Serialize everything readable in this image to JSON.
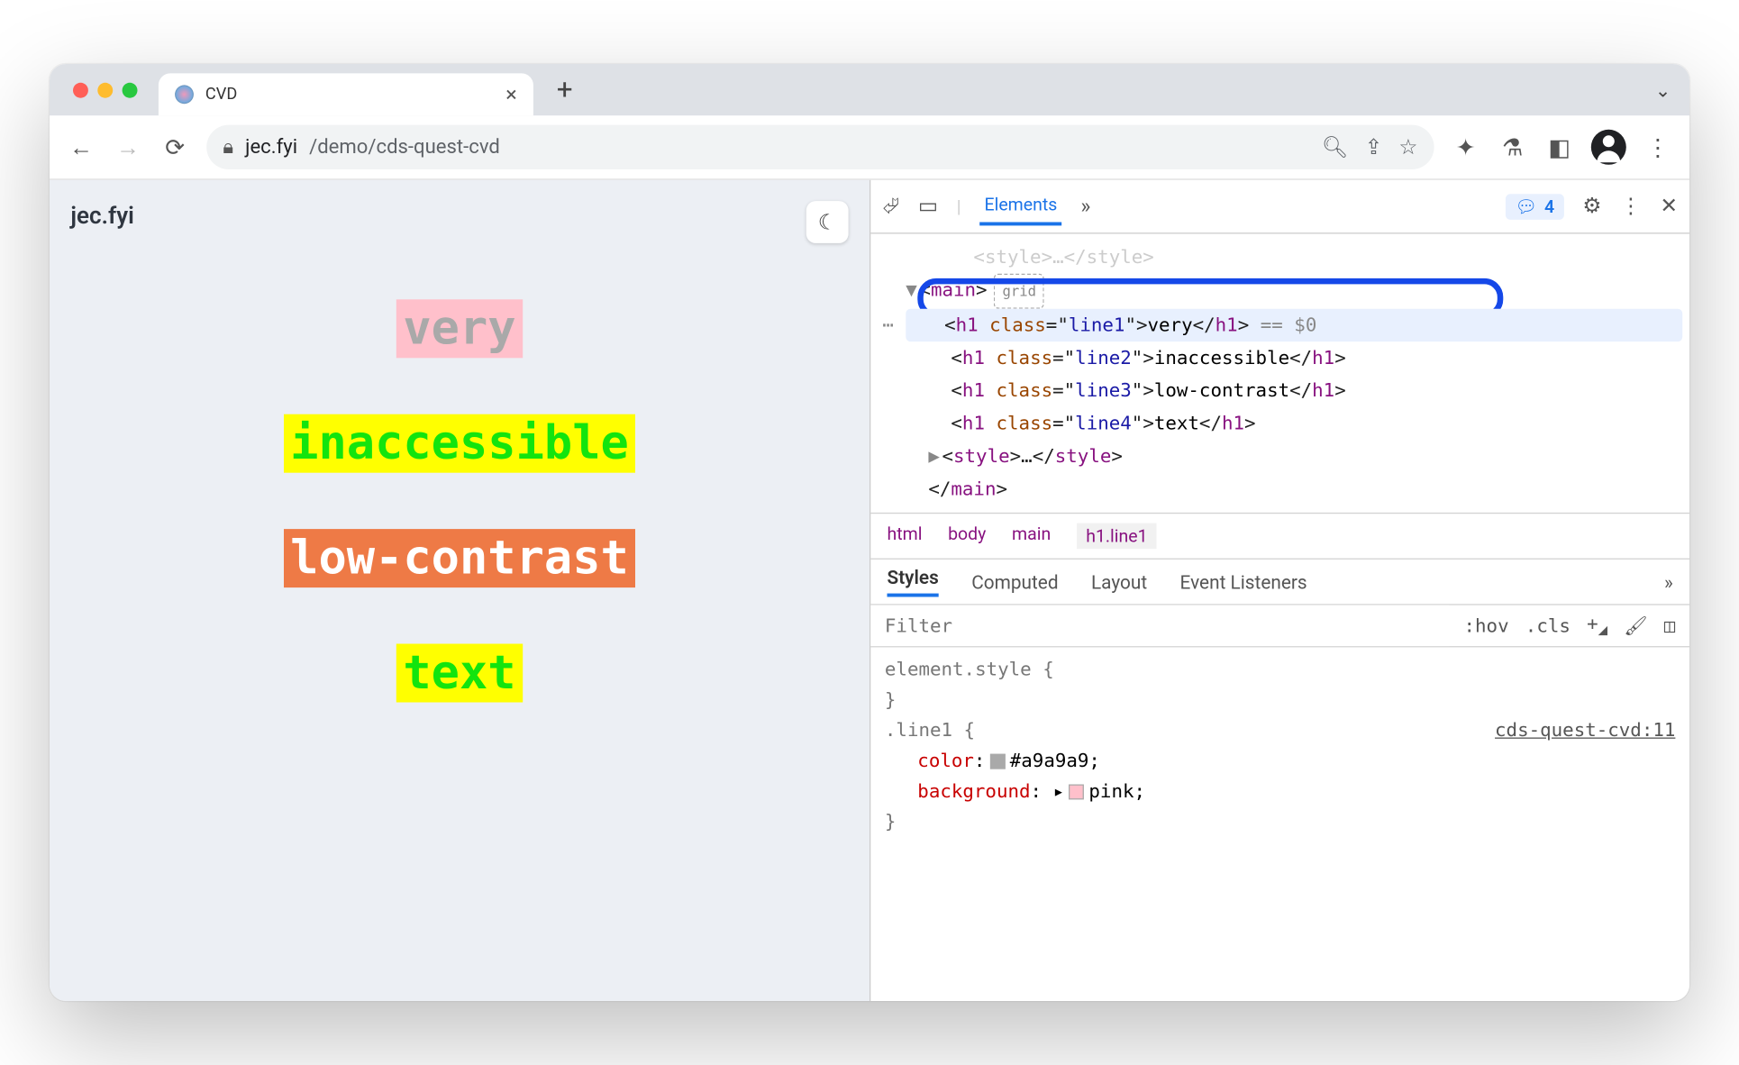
{
  "app": {
    "tab_title": "CVD",
    "url_host": "jec.fyi",
    "url_path": "/demo/cds-quest-cvd"
  },
  "page": {
    "brand": "jec.fyi",
    "lines": {
      "line1": "very",
      "line2": "inaccessible",
      "line3": "low-contrast",
      "line4": "text"
    }
  },
  "devtools": {
    "top_tabs": {
      "elements": "Elements"
    },
    "issue_count": "4",
    "dom": {
      "main_open": "main",
      "main_badge": "grid",
      "h1": "h1",
      "class_attr": "class",
      "line1_cls": "line1",
      "line1_txt": "very",
      "eq0": " == $0",
      "line2_cls": "line2",
      "line2_txt": "inaccessible",
      "line3_cls": "line3",
      "line3_txt": "low-contrast",
      "line4_cls": "line4",
      "line4_txt": "text",
      "style_tag": "style",
      "ellipsis": "…",
      "main_close": "main"
    },
    "crumbs": {
      "html": "html",
      "body": "body",
      "main": "main",
      "h1": "h1.line1"
    },
    "style_tabs": {
      "styles": "Styles",
      "computed": "Computed",
      "layout": "Layout",
      "listeners": "Event Listeners"
    },
    "filter_placeholder": "Filter",
    "hov": ":hov",
    "cls": ".cls",
    "element_style": "element.style {",
    "brace_close": "}",
    "rule_selector": ".line1 {",
    "source_link": "cds-quest-cvd:11",
    "color_prop": "color",
    "color_val": "#a9a9a9",
    "bg_prop": "background",
    "bg_val": "pink"
  }
}
